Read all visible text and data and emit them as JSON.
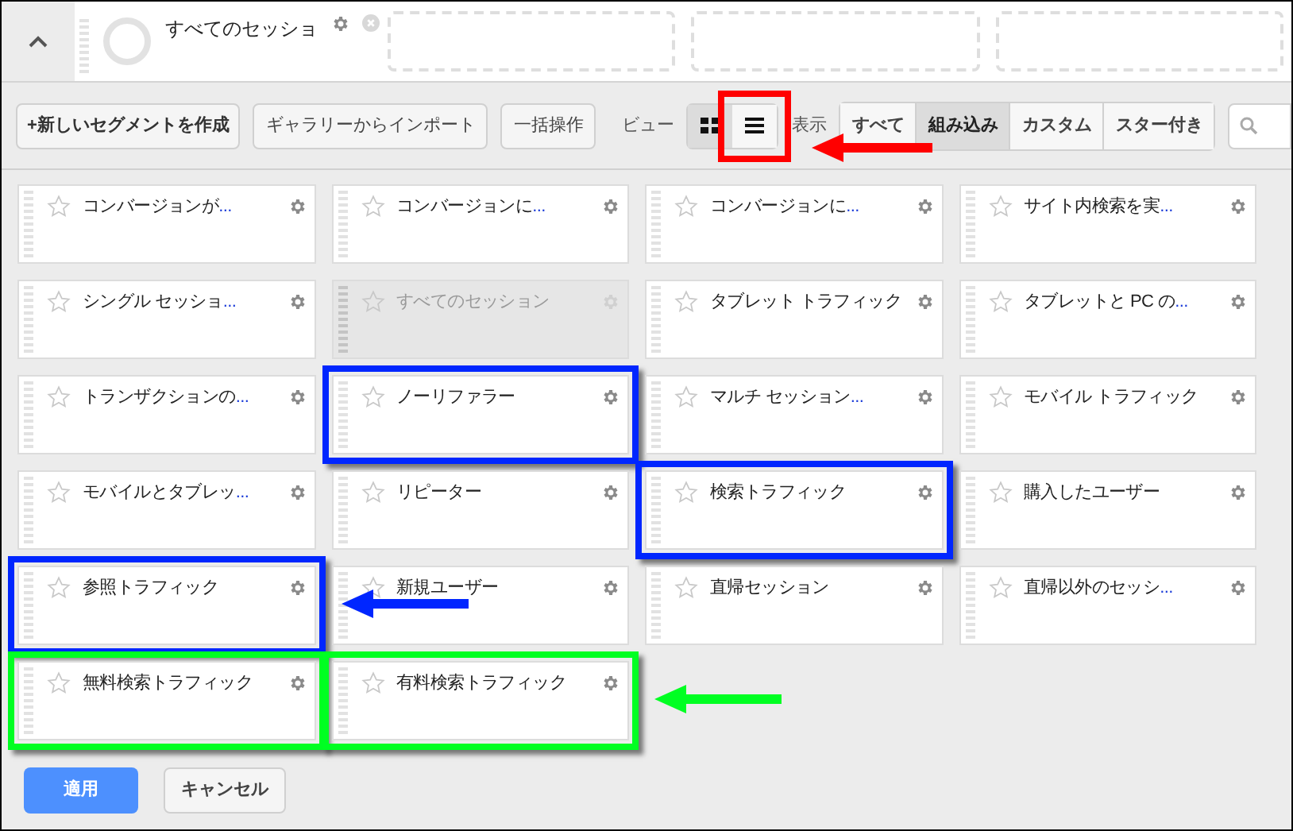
{
  "applied_segment": {
    "label": "すべてのセッショ"
  },
  "toolbar": {
    "create": "+新しいセグメントを作成",
    "import": "ギャラリーからインポート",
    "bulk": "一括操作",
    "view_label": "ビュー",
    "views": [
      {
        "kind": "grid",
        "selected": false
      },
      {
        "kind": "list",
        "selected": true,
        "color": "#ff0000"
      }
    ],
    "filter_label": "表示",
    "filters": [
      {
        "label": "すべて",
        "selected": false
      },
      {
        "label": "組み込み",
        "selected": true
      },
      {
        "label": "カスタム",
        "selected": false
      },
      {
        "label": "スター付き",
        "selected": false
      }
    ]
  },
  "segments": [
    {
      "label": "コンバージョンが",
      "more": "...",
      "disabled": false
    },
    {
      "label": "コンバージョンに",
      "more": "...",
      "disabled": false
    },
    {
      "label": "コンバージョンに",
      "more": "...",
      "disabled": false
    },
    {
      "label": "サイト内検索を実",
      "more": "...",
      "disabled": false
    },
    {
      "label": "シングル セッショ",
      "more": "...",
      "disabled": false
    },
    {
      "label": "すべてのセッション",
      "disabled": true
    },
    {
      "label": "タブレット トラフィック",
      "disabled": false
    },
    {
      "label": "タブレットと PC の",
      "more": "...",
      "disabled": false
    },
    {
      "label": "トランザクションの",
      "more": "...",
      "disabled": false
    },
    {
      "label": "ノーリファラー",
      "disabled": false,
      "color": "#0026ff"
    },
    {
      "label": "マルチ セッション",
      "more": "...",
      "disabled": false
    },
    {
      "label": "モバイル トラフィック",
      "disabled": false
    },
    {
      "label": "モバイルとタブレッ",
      "more": "...",
      "disabled": false
    },
    {
      "label": "リピーター",
      "disabled": false
    },
    {
      "label": "検索トラフィック",
      "disabled": false,
      "color": "#0026ff"
    },
    {
      "label": "購入したユーザー",
      "disabled": false
    },
    {
      "label": "参照トラフィック",
      "disabled": false,
      "color": "#0026ff",
      "arrow": true
    },
    {
      "label": "新規ユーザー",
      "disabled": false
    },
    {
      "label": "直帰セッション",
      "disabled": false
    },
    {
      "label": "直帰以外のセッシ",
      "more": "...",
      "disabled": false
    },
    {
      "label": "無料検索トラフィック",
      "disabled": false,
      "color": "#00ff22"
    },
    {
      "label": "有料検索トラフィック",
      "disabled": false,
      "color": "#00ff22",
      "arrow": true
    }
  ],
  "buttons": {
    "apply": "適用",
    "cancel": "キャンセル"
  }
}
